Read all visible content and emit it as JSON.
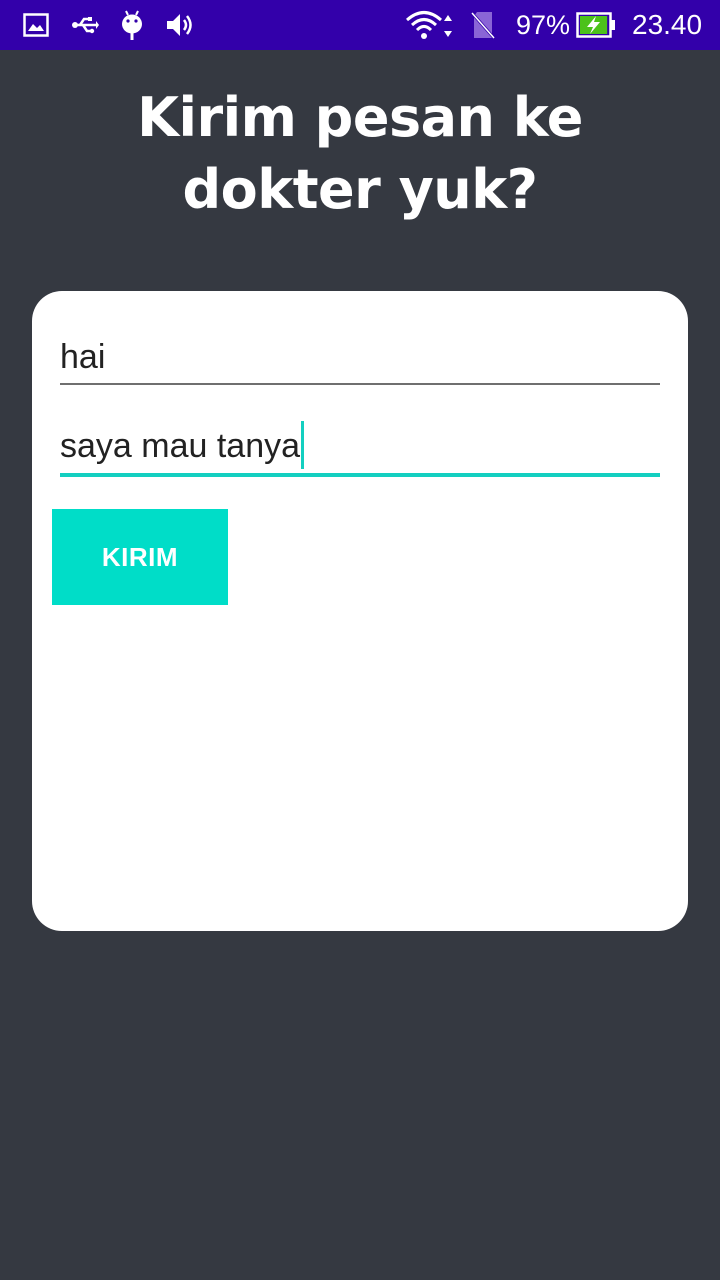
{
  "status_bar": {
    "icons": [
      "image-icon",
      "usb-icon",
      "android-debug-icon",
      "volume-icon",
      "wifi-icon",
      "no-sim-icon"
    ],
    "battery_percent_text": "97%",
    "battery_level": 0.97,
    "time": "23.40",
    "background_color": "#3300aa"
  },
  "screen": {
    "title": "Kirim pesan ke dokter yuk?",
    "background_color": "#353941"
  },
  "form": {
    "name_field": {
      "value": "hai"
    },
    "message_field": {
      "value": "saya mau tanya",
      "focused": true
    },
    "submit_label": "KIRIM",
    "accent_color": "#00ddc8"
  }
}
